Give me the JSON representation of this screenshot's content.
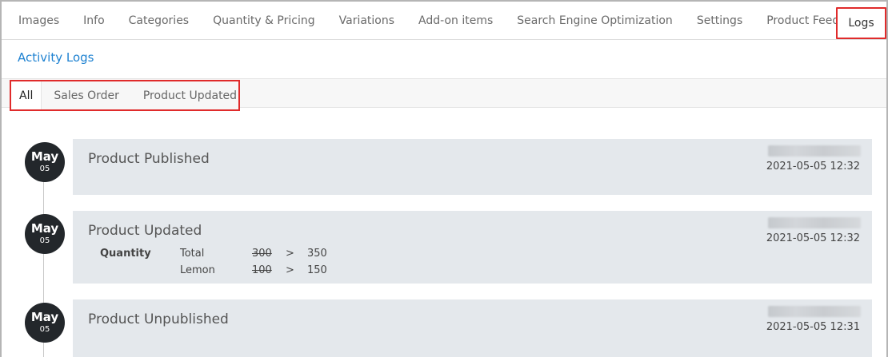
{
  "tabs": [
    {
      "label": "Images"
    },
    {
      "label": "Info"
    },
    {
      "label": "Categories"
    },
    {
      "label": "Quantity & Pricing"
    },
    {
      "label": "Variations"
    },
    {
      "label": "Add-on items"
    },
    {
      "label": "Search Engine Optimization"
    },
    {
      "label": "Settings"
    },
    {
      "label": "Product Feed Data"
    },
    {
      "label": "Logs",
      "active": true
    }
  ],
  "section_title": "Activity Logs",
  "filters": [
    {
      "label": "All",
      "active": true
    },
    {
      "label": "Sales Order"
    },
    {
      "label": "Product Updated"
    }
  ],
  "logs": [
    {
      "month": "May",
      "day": "05",
      "title": "Product Published",
      "timestamp": "2021-05-05 12:32"
    },
    {
      "month": "May",
      "day": "05",
      "title": "Product Updated",
      "timestamp": "2021-05-05 12:32",
      "changes": {
        "group": "Quantity",
        "rows": [
          {
            "field": "Total",
            "old": "300",
            "arrow": ">",
            "new": "350"
          },
          {
            "field": "Lemon",
            "old": "100",
            "arrow": ">",
            "new": "150"
          }
        ]
      }
    },
    {
      "month": "May",
      "day": "05",
      "title": "Product Unpublished",
      "timestamp": "2021-05-05 12:31"
    }
  ],
  "colors": {
    "accent_link": "#1f82d1",
    "highlight_border": "#e02b2b",
    "badge_bg": "#23272b",
    "card_bg": "#e4e8ec"
  }
}
